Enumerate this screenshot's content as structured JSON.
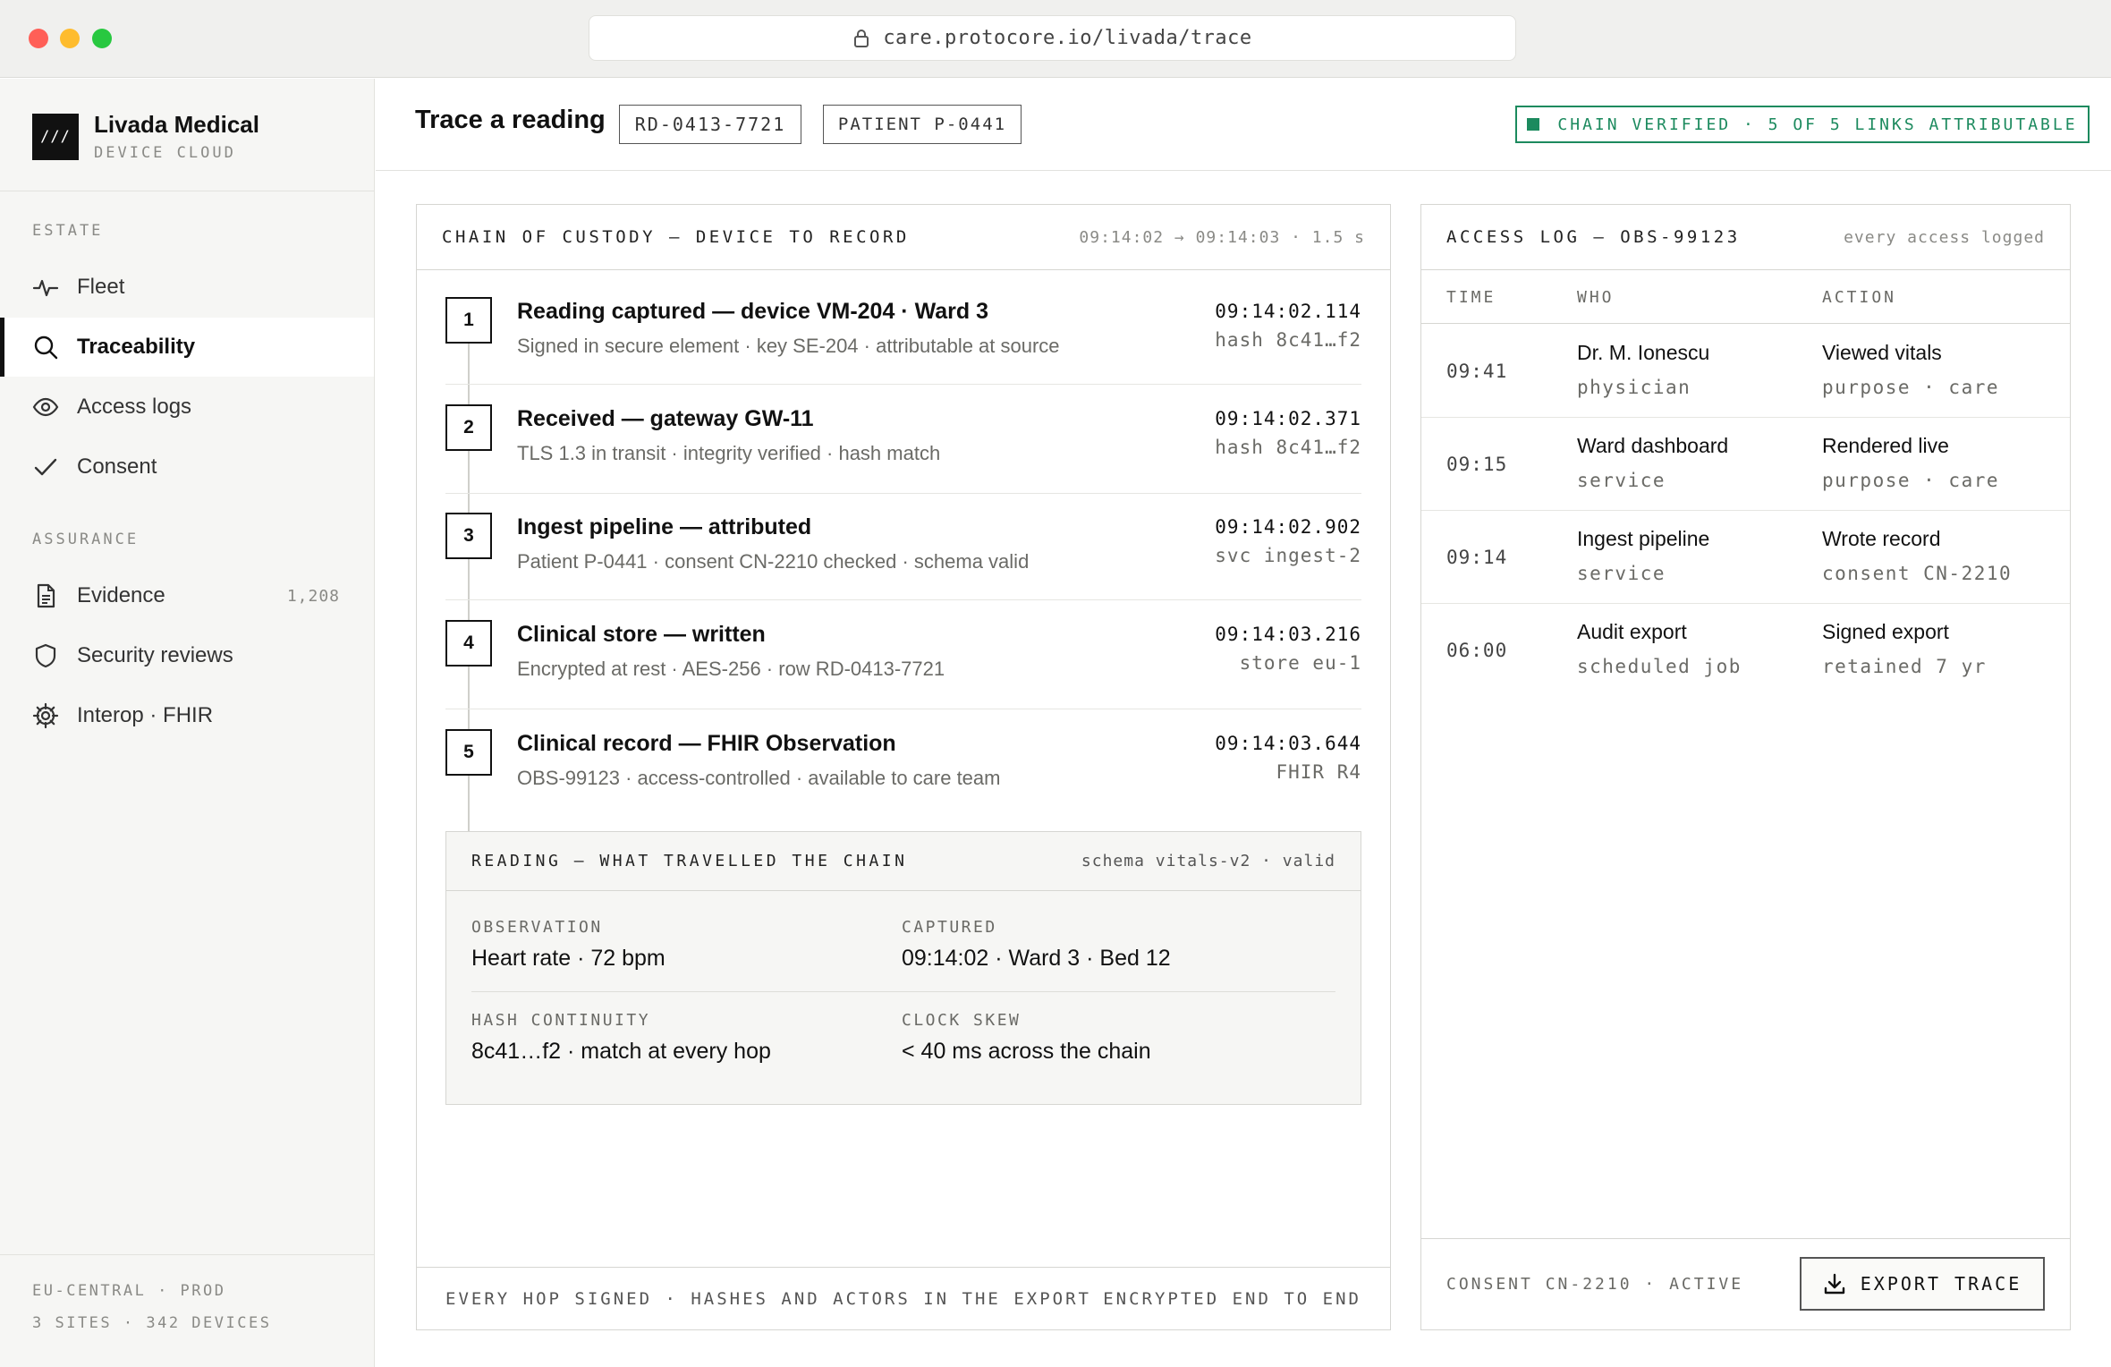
{
  "browser": {
    "url": "care.protocore.io/livada/trace"
  },
  "brand": {
    "logo_text": "///",
    "name": "Livada Medical",
    "subtitle": "DEVICE CLOUD"
  },
  "sidebar": {
    "sections": [
      {
        "label": "ESTATE",
        "items": [
          {
            "label": "Fleet",
            "icon": "pulse-icon",
            "active": false
          },
          {
            "label": "Traceability",
            "icon": "search-icon",
            "active": true
          },
          {
            "label": "Access logs",
            "icon": "eye-icon",
            "active": false
          },
          {
            "label": "Consent",
            "icon": "check-icon",
            "active": false
          }
        ]
      },
      {
        "label": "ASSURANCE",
        "items": [
          {
            "label": "Evidence",
            "icon": "document-icon",
            "count": "1,208",
            "active": false
          },
          {
            "label": "Security reviews",
            "icon": "shield-icon",
            "active": false
          },
          {
            "label": "Interop · FHIR",
            "icon": "gear-icon",
            "active": false
          }
        ]
      }
    ],
    "footer": {
      "line1": "EU-CENTRAL · PROD",
      "line2": "3 SITES · 342 DEVICES"
    }
  },
  "header": {
    "title": "Trace a reading",
    "reading_id": "RD-0413-7721",
    "patient": "PATIENT P-0441",
    "status": "CHAIN VERIFIED · 5 OF 5 LINKS ATTRIBUTABLE",
    "status_color": "#1c8a5e"
  },
  "chain": {
    "title": "CHAIN OF CUSTODY — DEVICE TO RECORD",
    "meta": "09:14:02 → 09:14:03 · 1.5 s",
    "steps": [
      {
        "num": "1",
        "title": "Reading captured — device VM-204 · Ward 3",
        "sub": "Signed in secure element · key SE-204 · attributable at source",
        "time": "09:14:02.114",
        "meta": "hash 8c41…f2"
      },
      {
        "num": "2",
        "title": "Received — gateway GW-11",
        "sub": "TLS 1.3 in transit · integrity verified · hash match",
        "time": "09:14:02.371",
        "meta": "hash 8c41…f2"
      },
      {
        "num": "3",
        "title": "Ingest pipeline — attributed",
        "sub": "Patient P-0441 · consent CN-2210 checked · schema valid",
        "time": "09:14:02.902",
        "meta": "svc ingest-2"
      },
      {
        "num": "4",
        "title": "Clinical store — written",
        "sub": "Encrypted at rest · AES-256 · row RD-0413-7721",
        "time": "09:14:03.216",
        "meta": "store eu-1"
      },
      {
        "num": "5",
        "title": "Clinical record — FHIR Observation",
        "sub": "OBS-99123 · access-controlled · available to care team",
        "time": "09:14:03.644",
        "meta": "FHIR R4"
      }
    ],
    "reading": {
      "title": "READING — WHAT TRAVELLED THE CHAIN",
      "meta": "schema vitals-v2 · valid",
      "observation_label": "OBSERVATION",
      "observation_value": "Heart rate · 72 bpm",
      "captured_label": "CAPTURED",
      "captured_value": "09:14:02 · Ward 3 · Bed 12",
      "hash_label": "HASH CONTINUITY",
      "hash_value": "8c41…f2 · match at every hop",
      "skew_label": "CLOCK SKEW",
      "skew_value": "< 40 ms across the chain"
    },
    "footer_left": "EVERY HOP SIGNED · HASHES AND ACTORS IN THE EXPORT",
    "footer_right": "ENCRYPTED END TO END"
  },
  "access_log": {
    "title": "ACCESS LOG — OBS-99123",
    "meta": "every access logged",
    "columns": [
      "TIME",
      "WHO",
      "ACTION"
    ],
    "rows": [
      {
        "time": "09:41",
        "who": "Dr. M. Ionescu",
        "who_sub": "physician",
        "action": "Viewed vitals",
        "action_sub": "purpose · care"
      },
      {
        "time": "09:15",
        "who": "Ward dashboard",
        "who_sub": "service",
        "action": "Rendered live",
        "action_sub": "purpose · care"
      },
      {
        "time": "09:14",
        "who": "Ingest pipeline",
        "who_sub": "service",
        "action": "Wrote record",
        "action_sub": "consent CN-2210"
      },
      {
        "time": "06:00",
        "who": "Audit export",
        "who_sub": "scheduled job",
        "action": "Signed export",
        "action_sub": "retained 7 yr"
      }
    ],
    "consent_status": "CONSENT CN-2210 · ACTIVE",
    "export_label": "EXPORT TRACE"
  }
}
